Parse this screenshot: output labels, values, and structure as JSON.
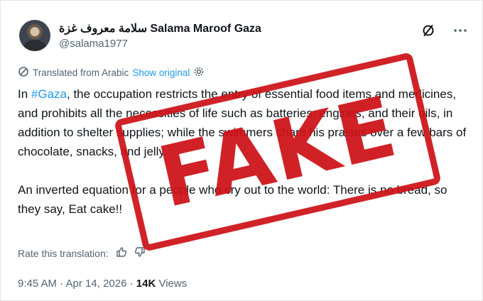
{
  "author": {
    "display_name": "سلامة معروف غزة Salama Maroof Gaza",
    "handle": "@salama1977"
  },
  "translation": {
    "label": "Translated from Arabic",
    "show_original": "Show original"
  },
  "post": {
    "p1_pre": "In ",
    "hashtag": "#Gaza",
    "p1_post": ", the occupation restricts the entry of essential food items and medicines, and prohibits all the necessities of life such as batteries, engines, and their oils, in addition to shelter supplies; while the swimmers chant his praises over a few bars of chocolate, snacks, and jelly.",
    "p2": "An inverted equation for a people who cry out to the world: There is no bread, so they say, Eat cake!!"
  },
  "rate": {
    "label": "Rate this translation:"
  },
  "meta": {
    "timestamp": "9:45 AM · Apr 14, 2026 · ",
    "views_count": "14K",
    "views_label": " Views"
  },
  "stamp": {
    "text": "FAKE",
    "color": "#cc1016"
  },
  "colors": {
    "link": "#1d9bf0",
    "secondary": "#536471",
    "text": "#0f1419"
  }
}
